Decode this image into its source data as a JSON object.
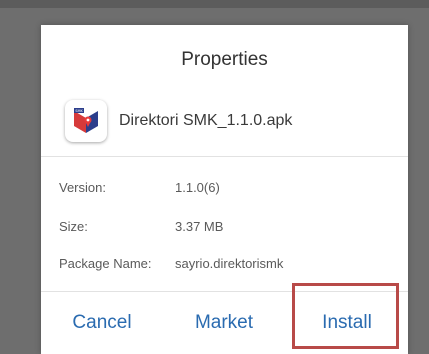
{
  "dialog": {
    "title": "Properties",
    "app_name": "Direktori SMK_1.1.0.apk",
    "app_icon": "app-logo-icon",
    "rows": [
      {
        "label": "Version:",
        "value": "1.1.0(6)"
      },
      {
        "label": "Size:",
        "value": "3.37 MB"
      },
      {
        "label": "Package Name:",
        "value": "sayrio.direktorismk"
      }
    ],
    "buttons": {
      "cancel": "Cancel",
      "market": "Market",
      "install": "Install"
    }
  },
  "colors": {
    "accent": "#2a6bb0",
    "highlight": "#b84a48",
    "overlay": "#6e6e6e"
  }
}
